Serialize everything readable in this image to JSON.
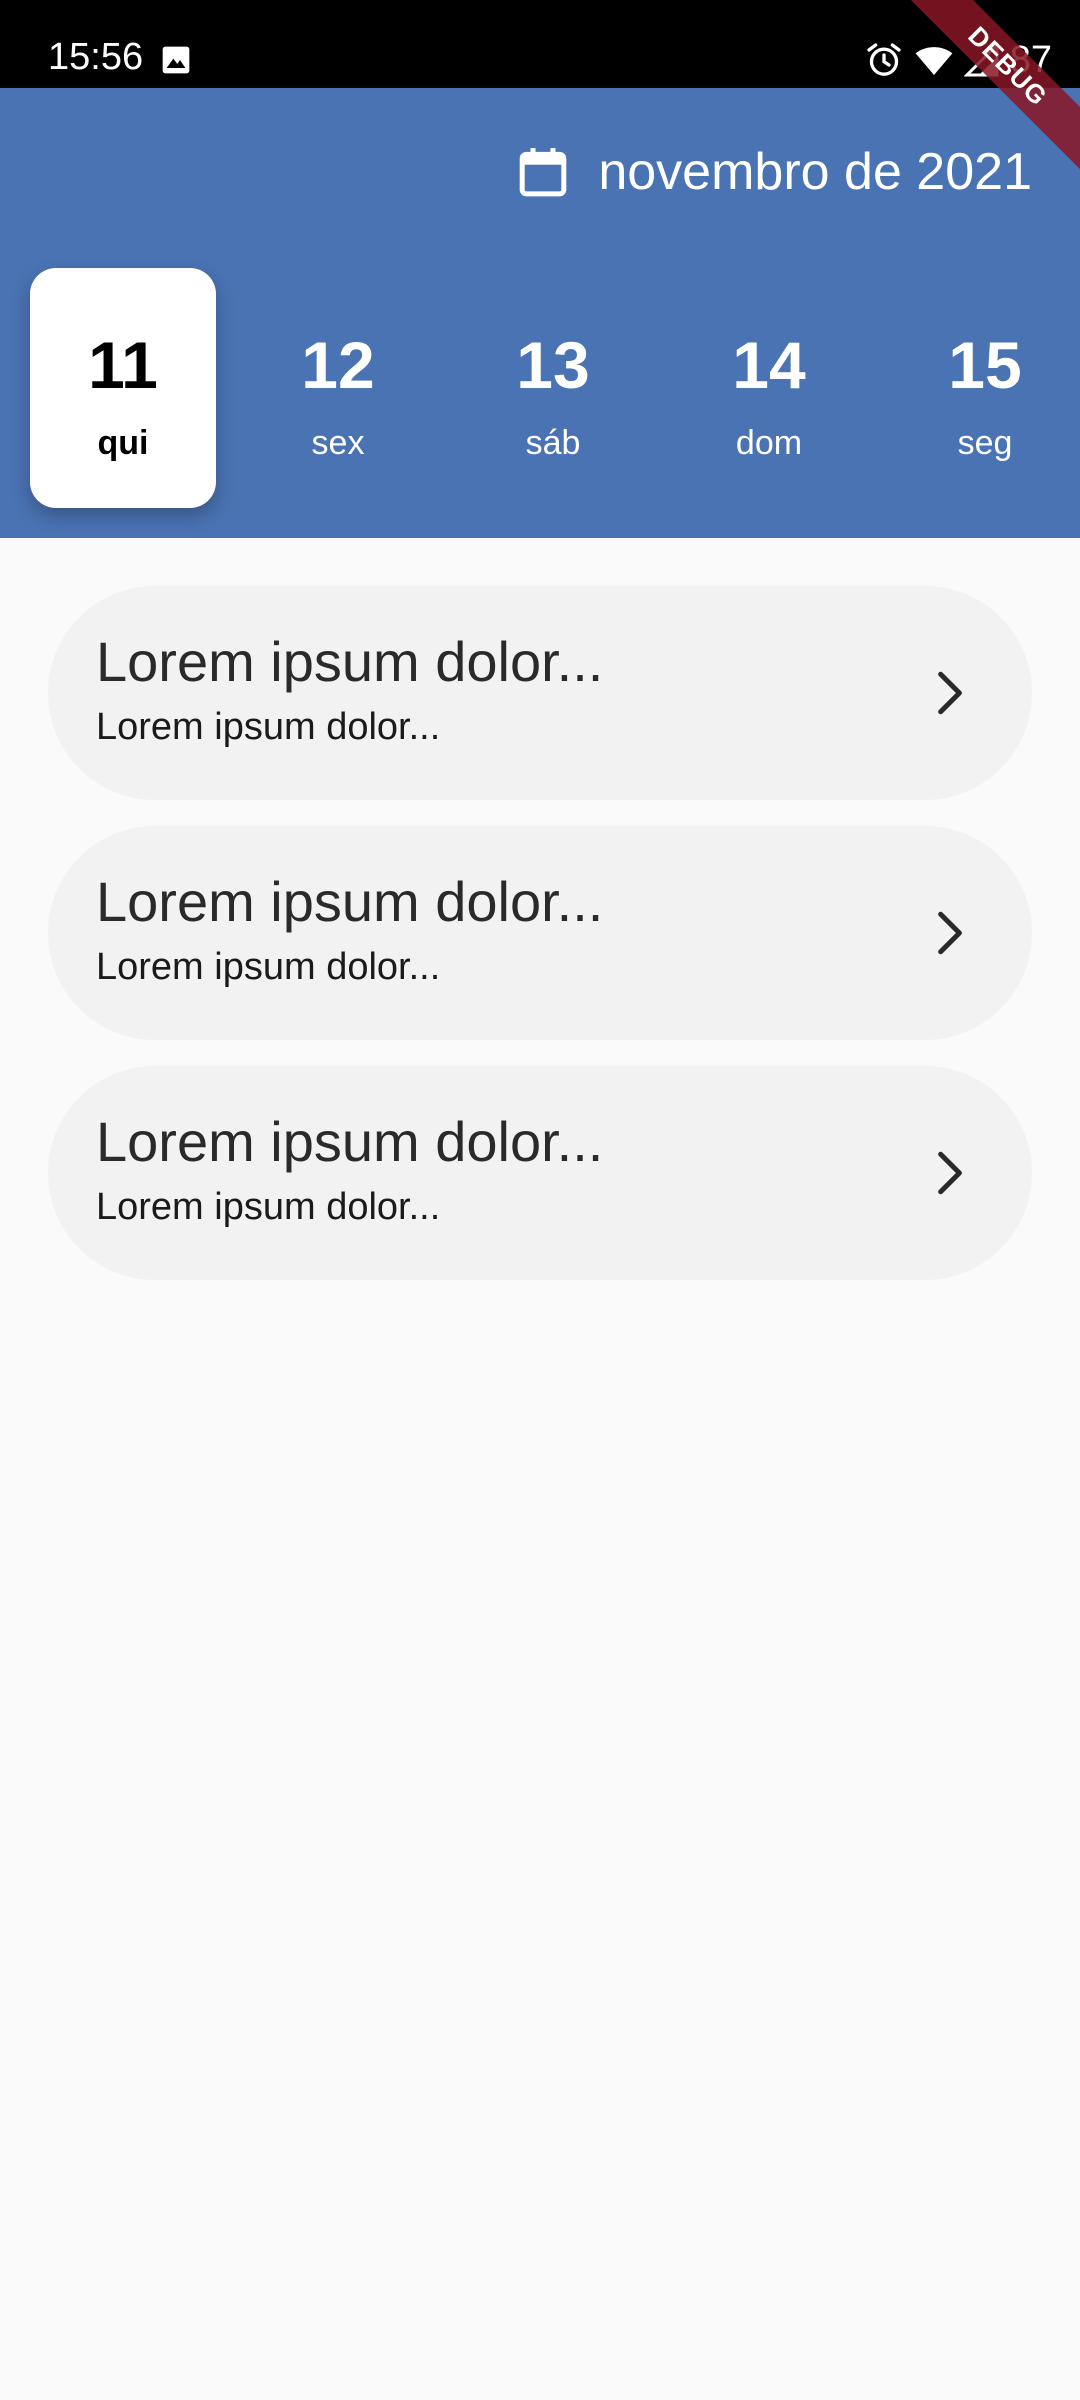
{
  "status_bar": {
    "time": "15:56",
    "battery": "87",
    "icons": [
      "image-icon",
      "alarm-icon",
      "wifi-icon",
      "signal-icon"
    ]
  },
  "debug_banner": "DEBUG",
  "header": {
    "month_label": "novembro de 2021",
    "icon": "calendar-icon",
    "background_color": "#4a73b3"
  },
  "days": [
    {
      "number": "11",
      "name": "qui",
      "selected": true
    },
    {
      "number": "12",
      "name": "sex",
      "selected": false
    },
    {
      "number": "13",
      "name": "sáb",
      "selected": false
    },
    {
      "number": "14",
      "name": "dom",
      "selected": false
    },
    {
      "number": "15",
      "name": "seg",
      "selected": false
    }
  ],
  "items": [
    {
      "title": "Lorem ipsum dolor...",
      "subtitle": "Lorem ipsum dolor...",
      "icon": "chevron-right-icon"
    },
    {
      "title": "Lorem ipsum dolor...",
      "subtitle": "Lorem ipsum dolor...",
      "icon": "chevron-right-icon"
    },
    {
      "title": "Lorem ipsum dolor...",
      "subtitle": "Lorem ipsum dolor...",
      "icon": "chevron-right-icon"
    }
  ]
}
